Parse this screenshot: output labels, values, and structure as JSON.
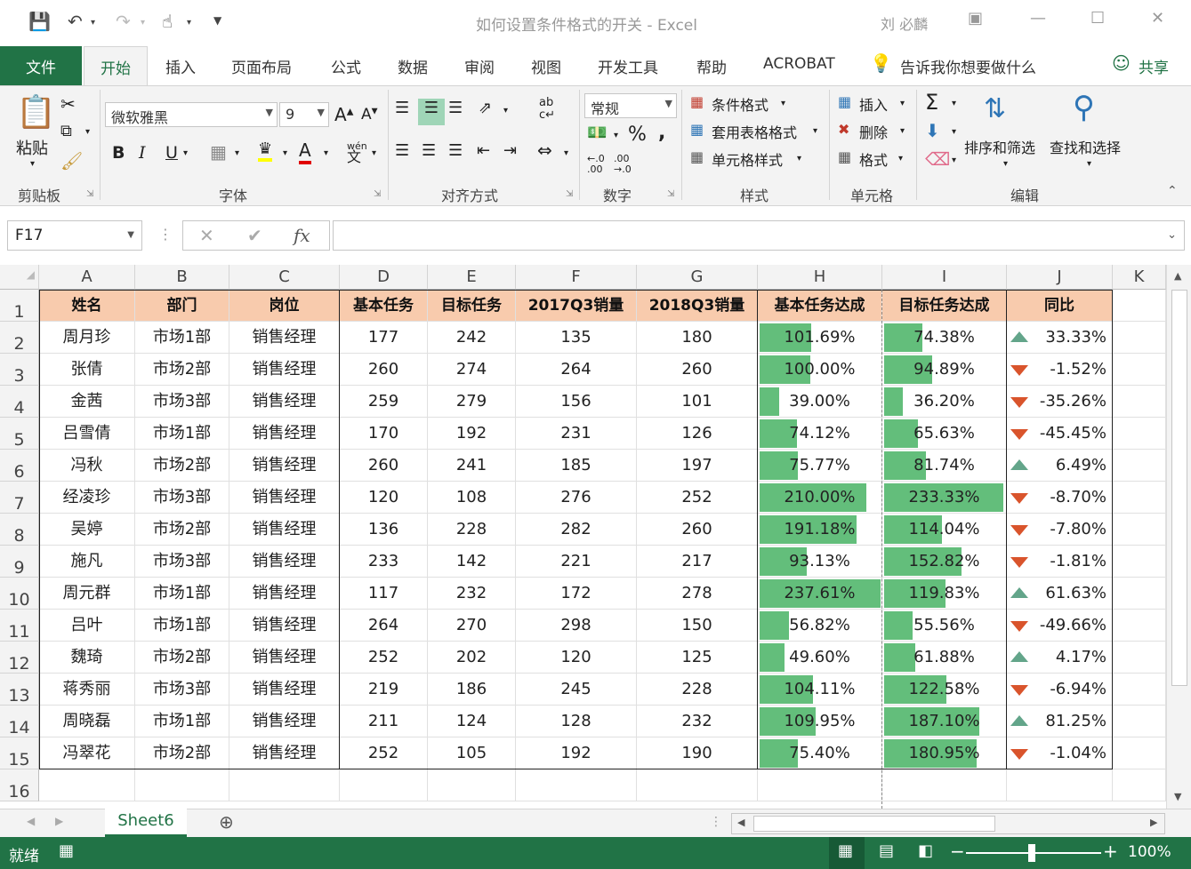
{
  "window": {
    "title": "如何设置条件格式的开关 - Excel",
    "user": "刘 必麟"
  },
  "ribbon_tabs": [
    "文件",
    "开始",
    "插入",
    "页面布局",
    "公式",
    "数据",
    "审阅",
    "视图",
    "开发工具",
    "帮助",
    "ACROBAT"
  ],
  "tell_me": "告诉我你想要做什么",
  "share": "共享",
  "ribbon": {
    "paste": "粘贴",
    "font_name": "微软雅黑",
    "font_size": "9",
    "number_format": "常规",
    "conditional_format": "条件格式",
    "table_format": "套用表格格式",
    "cell_style": "单元格样式",
    "insert": "插入",
    "delete": "删除",
    "format": "格式",
    "sort_filter": "排序和筛选",
    "find_select": "查找和选择",
    "groups": {
      "clipboard": "剪贴板",
      "font": "字体",
      "alignment": "对齐方式",
      "number": "数字",
      "styles": "样式",
      "cells": "单元格",
      "editing": "编辑"
    },
    "accent_color": "#217346"
  },
  "formula_bar": {
    "name_box": "F17",
    "formula": ""
  },
  "columns": [
    "A",
    "B",
    "C",
    "D",
    "E",
    "F",
    "G",
    "H",
    "I",
    "J",
    "K"
  ],
  "rows": [
    "1",
    "2",
    "3",
    "4",
    "5",
    "6",
    "7",
    "8",
    "9",
    "10",
    "11",
    "12",
    "13",
    "14",
    "15",
    "16"
  ],
  "table": {
    "headers": [
      "姓名",
      "部门",
      "岗位",
      "基本任务",
      "目标任务",
      "2017Q3销量",
      "2018Q3销量",
      "基本任务达成",
      "目标任务达成",
      "同比"
    ],
    "rows": [
      {
        "name": "周月珍",
        "dept": "市场1部",
        "pos": "销售经理",
        "base": "177",
        "target": "242",
        "q17": "135",
        "q18": "180",
        "base_rate": "101.69%",
        "base_frac": 1.0169,
        "target_rate": "74.38%",
        "target_frac": 0.7438,
        "yoy": "33.33%",
        "trend": "up"
      },
      {
        "name": "张倩",
        "dept": "市场2部",
        "pos": "销售经理",
        "base": "260",
        "target": "274",
        "q17": "264",
        "q18": "260",
        "base_rate": "100.00%",
        "base_frac": 1.0,
        "target_rate": "94.89%",
        "target_frac": 0.9489,
        "yoy": "-1.52%",
        "trend": "down"
      },
      {
        "name": "金茜",
        "dept": "市场3部",
        "pos": "销售经理",
        "base": "259",
        "target": "279",
        "q17": "156",
        "q18": "101",
        "base_rate": "39.00%",
        "base_frac": 0.39,
        "target_rate": "36.20%",
        "target_frac": 0.362,
        "yoy": "-35.26%",
        "trend": "down"
      },
      {
        "name": "吕雪倩",
        "dept": "市场1部",
        "pos": "销售经理",
        "base": "170",
        "target": "192",
        "q17": "231",
        "q18": "126",
        "base_rate": "74.12%",
        "base_frac": 0.7412,
        "target_rate": "65.63%",
        "target_frac": 0.6563,
        "yoy": "-45.45%",
        "trend": "down"
      },
      {
        "name": "冯秋",
        "dept": "市场2部",
        "pos": "销售经理",
        "base": "260",
        "target": "241",
        "q17": "185",
        "q18": "197",
        "base_rate": "75.77%",
        "base_frac": 0.7577,
        "target_rate": "81.74%",
        "target_frac": 0.8174,
        "yoy": "6.49%",
        "trend": "up"
      },
      {
        "name": "经凌珍",
        "dept": "市场3部",
        "pos": "销售经理",
        "base": "120",
        "target": "108",
        "q17": "276",
        "q18": "252",
        "base_rate": "210.00%",
        "base_frac": 2.1,
        "target_rate": "233.33%",
        "target_frac": 2.3333,
        "yoy": "-8.70%",
        "trend": "down"
      },
      {
        "name": "吴婷",
        "dept": "市场2部",
        "pos": "销售经理",
        "base": "136",
        "target": "228",
        "q17": "282",
        "q18": "260",
        "base_rate": "191.18%",
        "base_frac": 1.9118,
        "target_rate": "114.04%",
        "target_frac": 1.1404,
        "yoy": "-7.80%",
        "trend": "down"
      },
      {
        "name": "施凡",
        "dept": "市场3部",
        "pos": "销售经理",
        "base": "233",
        "target": "142",
        "q17": "221",
        "q18": "217",
        "base_rate": "93.13%",
        "base_frac": 0.9313,
        "target_rate": "152.82%",
        "target_frac": 1.5282,
        "yoy": "-1.81%",
        "trend": "down"
      },
      {
        "name": "周元群",
        "dept": "市场1部",
        "pos": "销售经理",
        "base": "117",
        "target": "232",
        "q17": "172",
        "q18": "278",
        "base_rate": "237.61%",
        "base_frac": 2.3761,
        "target_rate": "119.83%",
        "target_frac": 1.1983,
        "yoy": "61.63%",
        "trend": "up"
      },
      {
        "name": "吕叶",
        "dept": "市场1部",
        "pos": "销售经理",
        "base": "264",
        "target": "270",
        "q17": "298",
        "q18": "150",
        "base_rate": "56.82%",
        "base_frac": 0.5682,
        "target_rate": "55.56%",
        "target_frac": 0.5556,
        "yoy": "-49.66%",
        "trend": "down"
      },
      {
        "name": "魏琦",
        "dept": "市场2部",
        "pos": "销售经理",
        "base": "252",
        "target": "202",
        "q17": "120",
        "q18": "125",
        "base_rate": "49.60%",
        "base_frac": 0.496,
        "target_rate": "61.88%",
        "target_frac": 0.6188,
        "yoy": "4.17%",
        "trend": "up"
      },
      {
        "name": "蒋秀丽",
        "dept": "市场3部",
        "pos": "销售经理",
        "base": "219",
        "target": "186",
        "q17": "245",
        "q18": "228",
        "base_rate": "104.11%",
        "base_frac": 1.0411,
        "target_rate": "122.58%",
        "target_frac": 1.2258,
        "yoy": "-6.94%",
        "trend": "down"
      },
      {
        "name": "周晓磊",
        "dept": "市场1部",
        "pos": "销售经理",
        "base": "211",
        "target": "124",
        "q17": "128",
        "q18": "232",
        "base_rate": "109.95%",
        "base_frac": 1.0995,
        "target_rate": "187.10%",
        "target_frac": 1.871,
        "yoy": "81.25%",
        "trend": "up"
      },
      {
        "name": "冯翠花",
        "dept": "市场2部",
        "pos": "销售经理",
        "base": "252",
        "target": "105",
        "q17": "192",
        "q18": "190",
        "base_rate": "75.40%",
        "base_frac": 0.754,
        "target_rate": "180.95%",
        "target_frac": 1.8095,
        "yoy": "-1.04%",
        "trend": "down"
      }
    ],
    "header_color": "#f8cbad",
    "bar_color": "#63be7b",
    "up_color": "#63a58a",
    "down_color": "#d9542c"
  },
  "sheet_tab": "Sheet6",
  "status": {
    "text": "就绪",
    "zoom": "100%"
  }
}
